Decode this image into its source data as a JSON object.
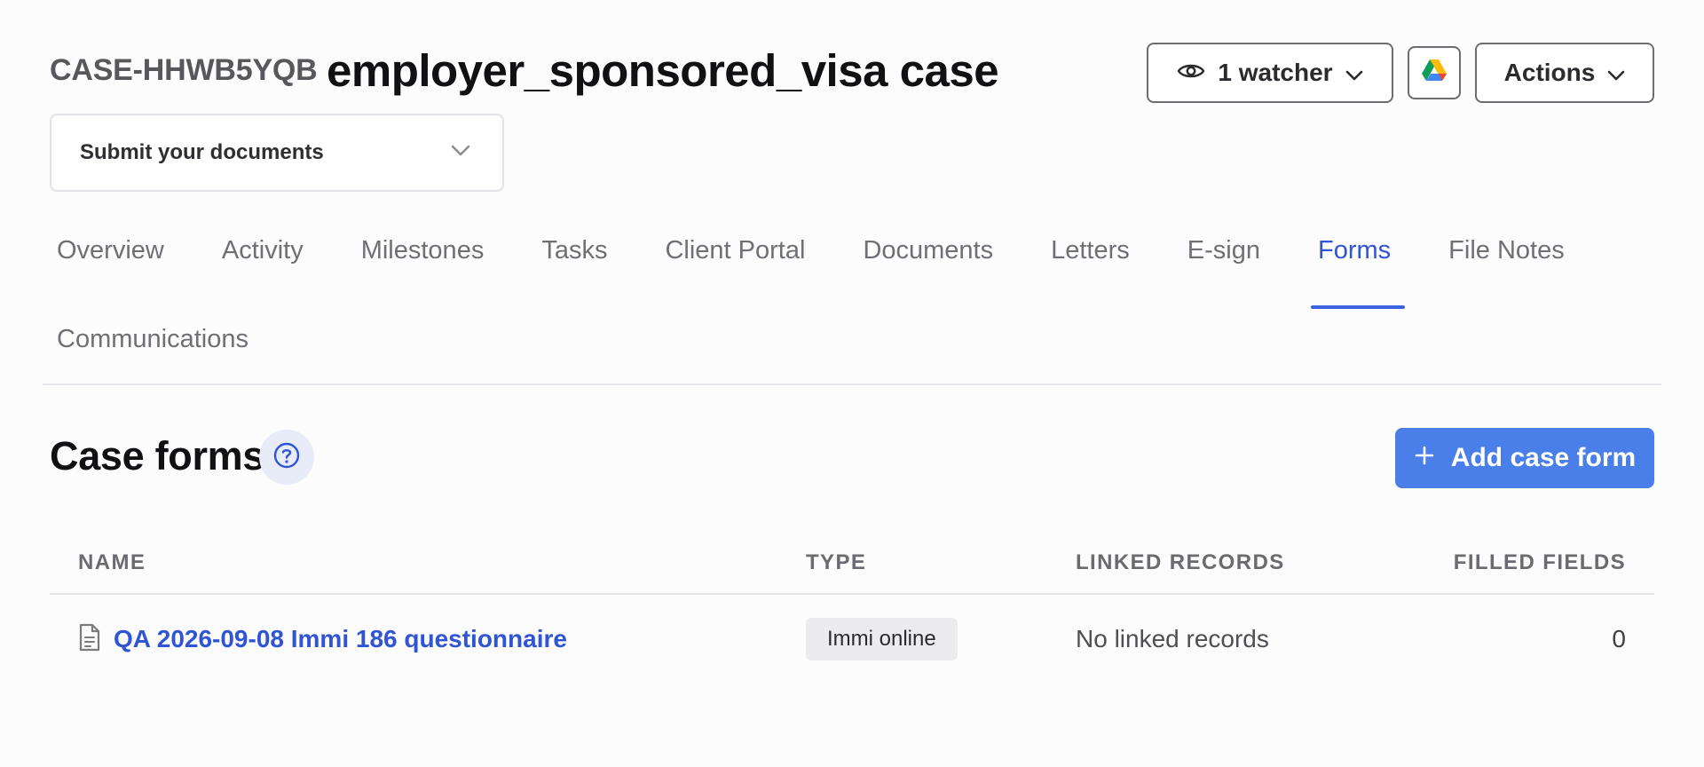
{
  "header": {
    "case_id": "CASE-HHWB5YQB",
    "case_title": "employer_sponsored_visa case",
    "watchers_label": "1 watcher",
    "actions_label": "Actions"
  },
  "status": {
    "selected": "Submit your documents"
  },
  "tabs": [
    {
      "label": "Overview",
      "active": false
    },
    {
      "label": "Activity",
      "active": false
    },
    {
      "label": "Milestones",
      "active": false
    },
    {
      "label": "Tasks",
      "active": false
    },
    {
      "label": "Client Portal",
      "active": false
    },
    {
      "label": "Documents",
      "active": false
    },
    {
      "label": "Letters",
      "active": false
    },
    {
      "label": "E-sign",
      "active": false
    },
    {
      "label": "Forms",
      "active": true
    },
    {
      "label": "File Notes",
      "active": false
    },
    {
      "label": "Communications",
      "active": false
    }
  ],
  "section": {
    "title": "Case forms",
    "add_button_label": "Add case form"
  },
  "table": {
    "columns": [
      "NAME",
      "TYPE",
      "LINKED RECORDS",
      "FILLED FIELDS"
    ],
    "rows": [
      {
        "name": "QA 2026-09-08 Immi 186 questionnaire",
        "type": "Immi online",
        "linked_records": "No linked records",
        "filled_fields": "0"
      }
    ]
  },
  "colors": {
    "accent": "#2f55d4",
    "primary_button": "#4a7ee8",
    "help_bg": "#e7ecf8"
  },
  "icons": {
    "watchers": "eye-icon",
    "drive": "google-drive-icon",
    "help": "question-circle-icon",
    "add": "plus-icon",
    "document": "document-icon"
  }
}
